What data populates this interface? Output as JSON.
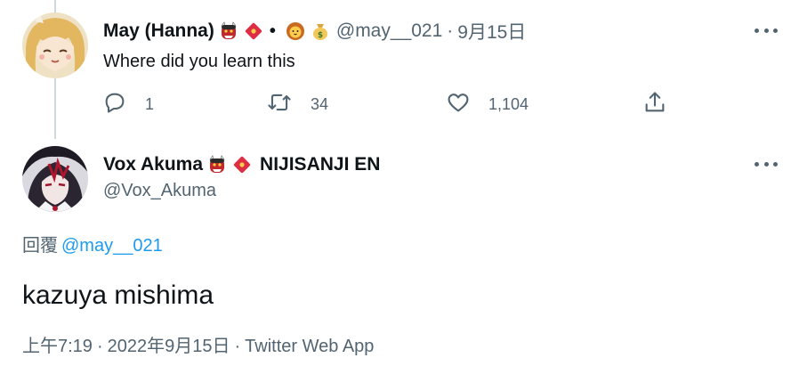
{
  "reply_tweet": {
    "author_name": "May (Hanna)",
    "name_emojis": [
      "ogre-emoji",
      "red-envelope-emoji"
    ],
    "bullet": "•",
    "extra_emojis": [
      "lion-emoji",
      "money-bag-emoji"
    ],
    "handle": "@may__021",
    "date_separator": "·",
    "date": "9月15日",
    "text": "Where did you learn this",
    "actions": {
      "reply_count": "1",
      "retweet_count": "34",
      "like_count": "1,104"
    }
  },
  "main_tweet": {
    "author_name": "Vox Akuma",
    "name_emojis": [
      "ogre-emoji",
      "red-envelope-emoji"
    ],
    "org": "NIJISANJI EN",
    "handle": "@Vox_Akuma",
    "replying_prefix": "回覆",
    "replying_mention": "@may__021",
    "text": "kazuya mishima",
    "time": "上午7:19",
    "separator": "·",
    "date": "2022年9月15日",
    "source": "Twitter Web App"
  },
  "colors": {
    "text": "#0f1419",
    "muted": "#536471",
    "link": "#1d9bf0",
    "thread_line": "#cfd9de"
  }
}
